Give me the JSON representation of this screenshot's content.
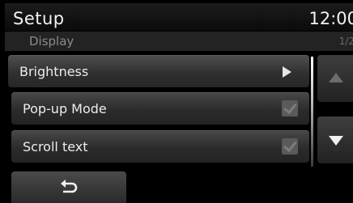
{
  "header": {
    "title": "Setup",
    "clock": "12:00"
  },
  "subheader": {
    "title": "Display",
    "page_indicator": "1/2"
  },
  "menu": {
    "items": [
      {
        "label": "Brightness",
        "type": "submenu"
      },
      {
        "label": "Pop-up Mode",
        "type": "checkbox",
        "checked": true
      },
      {
        "label": "Scroll text",
        "type": "checkbox",
        "checked": true
      }
    ]
  },
  "scroll": {
    "up_icon": "triangle-up-icon",
    "down_icon": "triangle-down-icon",
    "up_enabled": false,
    "down_enabled": true
  },
  "footer": {
    "back_icon": "return-arrow-icon"
  },
  "colors": {
    "background": "#000000",
    "text": "#ececec",
    "muted": "#8a8a8a"
  }
}
